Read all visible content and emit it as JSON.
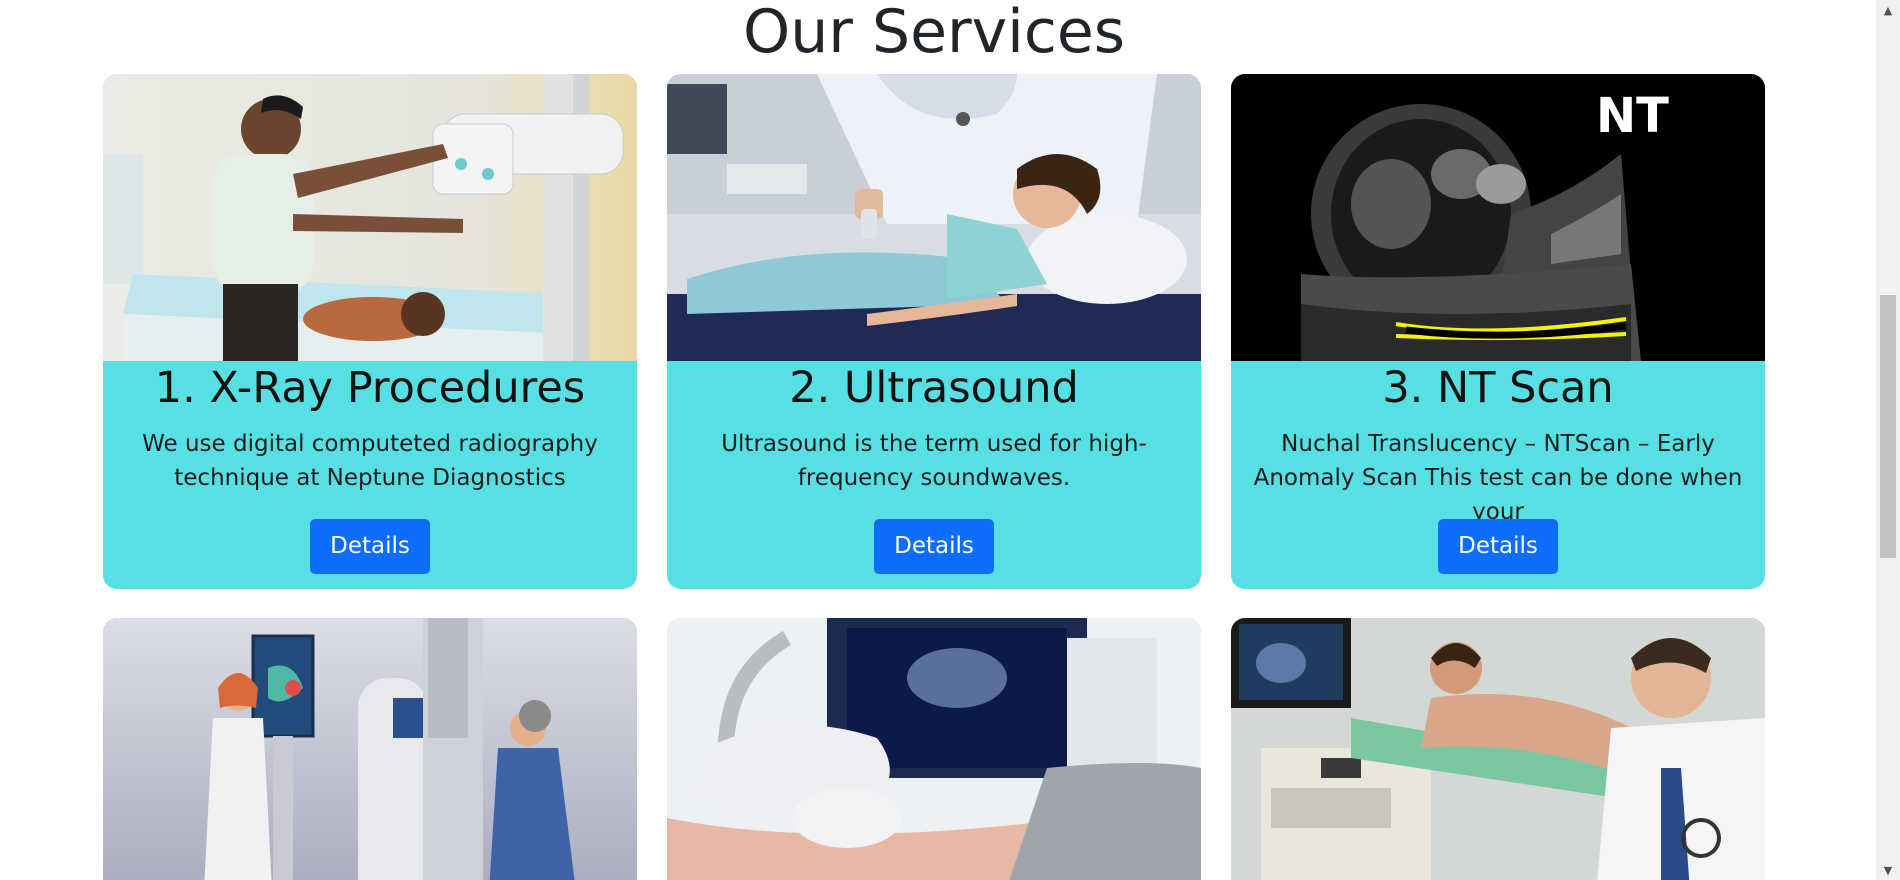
{
  "section": {
    "title": "Our Services"
  },
  "cards": [
    {
      "title": "1. X-Ray Procedures",
      "text": "We use digital computeted radiography technique at Neptune Diagnostics",
      "button": "Details",
      "image": "xray-machine-photo"
    },
    {
      "title": "2. Ultrasound",
      "text": "Ultrasound is the term used for high-frequency soundwaves.",
      "button": "Details",
      "image": "ultrasound-child-photo"
    },
    {
      "title": "3. NT Scan",
      "text": "Nuchal Translucency – NTScan – Early Anomaly Scan This test can be done when your",
      "button": "Details",
      "image": "nt-scan-ultrasound-image",
      "image_label": "NT"
    },
    {
      "image": "mammography-illustration"
    },
    {
      "image": "ultrasound-probe-photo"
    },
    {
      "image": "echocardiography-photo"
    }
  ],
  "colors": {
    "card_bg": "#57e0e3",
    "button_bg": "#0d6efd",
    "button_text": "#ffffff"
  },
  "icons": {
    "scroll_up": "scroll-up-arrow-icon",
    "scroll_down": "scroll-down-arrow-icon"
  }
}
